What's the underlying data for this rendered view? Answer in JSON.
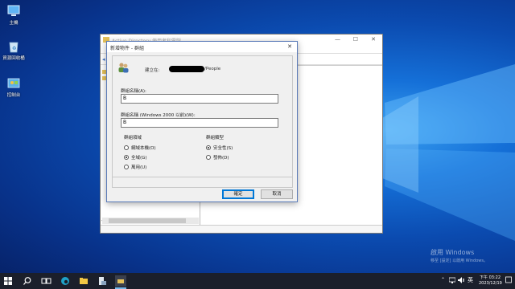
{
  "desktop": {
    "icons": [
      {
        "label": "主機"
      },
      {
        "label": "資源回收桶"
      },
      {
        "label": "控制台"
      }
    ]
  },
  "background_window": {
    "title": "Active Directory 使用者和電腦"
  },
  "dialog": {
    "title": "新增物件 - 群組",
    "close_glyph": "✕",
    "create_in_label": "建立在:",
    "create_in_value": "/People",
    "group_name_label": "群組名稱(A):",
    "group_name_value": "B",
    "group_name_pre2000_label": "群組名稱 (Windows 2000 以前)(W):",
    "group_name_pre2000_value": "B",
    "scope": {
      "legend": "群組領域",
      "options": [
        {
          "label": "網域本機(O)",
          "selected": false
        },
        {
          "label": "全域(G)",
          "selected": true
        },
        {
          "label": "萬用(U)",
          "selected": false
        }
      ]
    },
    "type": {
      "legend": "群組類型",
      "options": [
        {
          "label": "安全性(S)",
          "selected": true
        },
        {
          "label": "發佈(D)",
          "selected": false
        }
      ]
    },
    "ok_label": "確定",
    "cancel_label": "取消"
  },
  "watermark": {
    "line1": "啟用 Windows",
    "line2": "移至 [設定] 以啟用 Windows。"
  },
  "taskbar": {
    "ime": "英",
    "time": "下午 03:22",
    "date": "2023/12/19"
  },
  "colors": {
    "accent": "#0078d7",
    "taskbar": "#1b1f2b"
  }
}
